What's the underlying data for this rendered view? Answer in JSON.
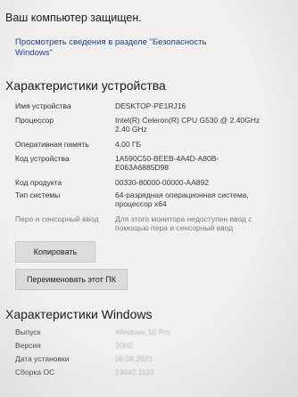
{
  "status": {
    "title": "Ваш компьютер защищен.",
    "link": "Просмотреть сведения в разделе \"Безопасность Windows\""
  },
  "device_specs": {
    "heading": "Характеристики устройства",
    "rows": [
      {
        "label": "Имя устройства",
        "value": "DESKTOP-PE1RJ16"
      },
      {
        "label": "Процессор",
        "value": "Intel(R) Celeron(R) CPU G530 @ 2.40GHz 2.40 GHz"
      },
      {
        "label": "Оперативная память",
        "value": "4.00 ГБ"
      },
      {
        "label": "Код устройства",
        "value": "1A590C50-BEEB-4A4D-A80B-E063A6885D98"
      },
      {
        "label": "Код продукта",
        "value": "00330-80000-00000-AA892"
      },
      {
        "label": "Тип системы",
        "value": "64-разрядная операционная система, процессор x64"
      },
      {
        "label": "Перо и сенсорный ввод",
        "value": "Для этого монитора недоступен ввод с помощью пера и сенсорный ввод"
      }
    ],
    "copy_button": "Копировать",
    "rename_button": "Переименовать этот ПК"
  },
  "windows_specs": {
    "heading": "Характеристики Windows",
    "rows": [
      {
        "label": "Выпуск",
        "value": "Windows 10 Pro"
      },
      {
        "label": "Версия",
        "value": "20H2"
      },
      {
        "label": "Дата установки",
        "value": "06.08.2021"
      },
      {
        "label": "Сборка ОС",
        "value": "19042.1110"
      }
    ]
  }
}
